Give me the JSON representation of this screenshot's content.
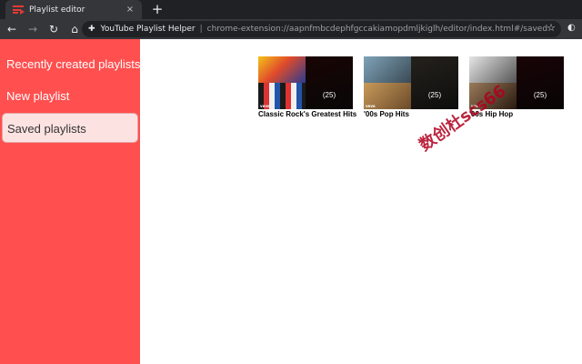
{
  "browser": {
    "tab_title": "Playlist editor",
    "tab_close": "×",
    "new_tab": "+",
    "back_icon": "←",
    "forward_icon": "→",
    "reload_icon": "↻",
    "home_icon": "⌂",
    "extension_name": "YouTube Playlist Helper",
    "separator": "|",
    "url": "chrome-extension://aapnfmbcdephfgccakiamopdmljkiglh/editor/index.html#/saved",
    "star_icon": "☆"
  },
  "sidebar": {
    "items": [
      {
        "label": "Recently created playlists"
      },
      {
        "label": "New playlist"
      },
      {
        "label": "Saved playlists"
      }
    ],
    "active": "Saved playlists"
  },
  "playlists": [
    {
      "title": "Classic Rock's Greatest Hits",
      "count": "(25)",
      "vevo": "vevo"
    },
    {
      "title": "'00s Pop Hits",
      "count": "(25)",
      "vevo": "vevo"
    },
    {
      "title": "'00s Hip Hop",
      "count": "(25)",
      "vevo": "vevo"
    }
  ],
  "colors": {
    "sidebar_bg": "#ff4f4f",
    "sidebar_active_bg": "#fde2e2",
    "browser_dark": "#202124"
  },
  "watermark": "数创杜scs66"
}
